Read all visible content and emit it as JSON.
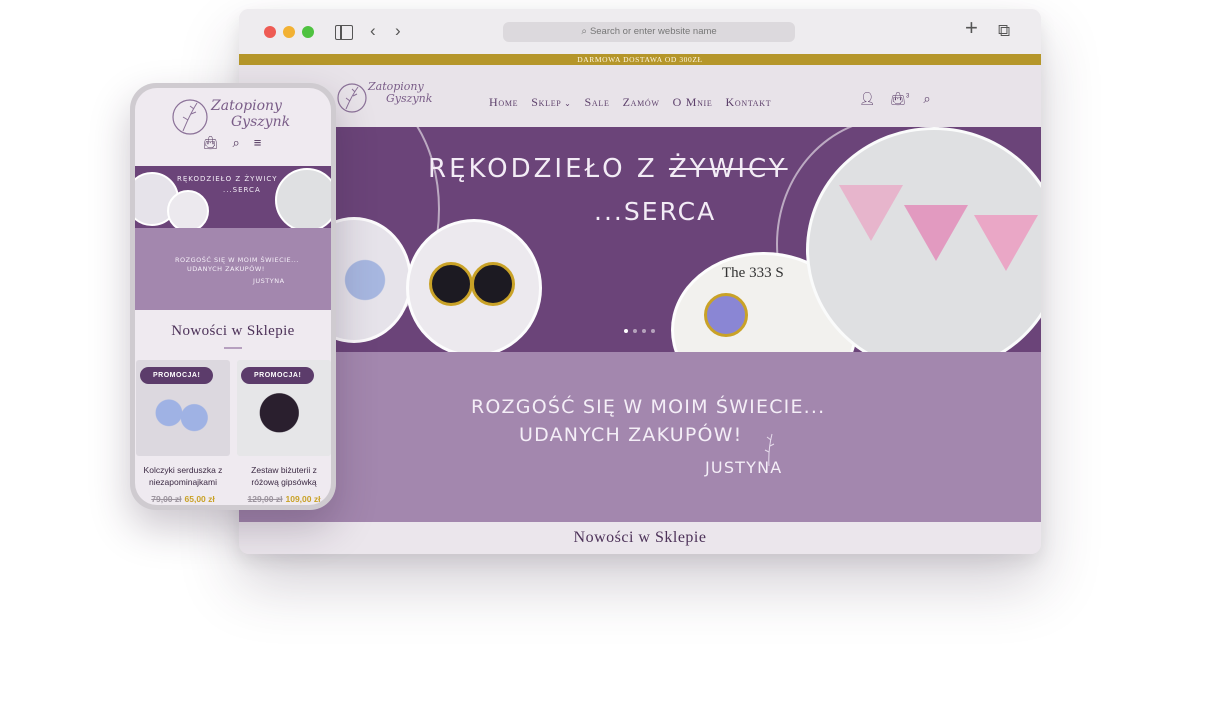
{
  "browser": {
    "address_placeholder": "Search or enter website name"
  },
  "site": {
    "promo_bar": "DARMOWA DOSTAWA OD 300ZŁ",
    "logo_line1": "Zatopiony",
    "logo_line2": "Gyszynk",
    "nav": [
      "Home",
      "Sklep",
      "Sale",
      "Zamów",
      "O Mnie",
      "Kontakt"
    ],
    "cart_count": "3",
    "hero": {
      "line1_prefix": "RĘKODZIEŁO Z",
      "line1_struck": "ŻYWICY",
      "line2": "...SERCA",
      "photo_text": "The 333 S",
      "slides": 4,
      "active_slide": 0
    },
    "welcome": {
      "line1": "ROZGOŚĆ SIĘ W MOIM ŚWIECIE...",
      "line2": "UDANYCH ZAKUPÓW!",
      "signature": "JUSTYNA"
    },
    "new_title": "Nowości w Sklepie"
  },
  "phone": {
    "logo_line1": "Zatopiony",
    "logo_line2": "Gyszynk",
    "hero_line1": "RĘKODZIEŁO Z ŻYWICY",
    "hero_line2": "...SERCA",
    "welcome_line1": "ROZGOŚĆ SIĘ W MOIM ŚWIECIE...",
    "welcome_line2": "UDANYCH ZAKUPÓW!",
    "welcome_sig": "JUSTYNA",
    "new_title": "Nowości w Sklepie",
    "products": [
      {
        "badge": "PROMOCJA!",
        "name": "Kolczyki serduszka z niezapominajkami",
        "old_price": "79,00 zł",
        "new_price": "65,00 zł"
      },
      {
        "badge": "PROMOCJA!",
        "name": "Zestaw biżuterii z różową gipsówką",
        "old_price": "129,00 zł",
        "new_price": "109,00 zł"
      }
    ]
  },
  "colors": {
    "brand_purple": "#6b4479",
    "lavender": "#a387ae",
    "gold": "#b5962a",
    "price_gold": "#c9a227"
  }
}
